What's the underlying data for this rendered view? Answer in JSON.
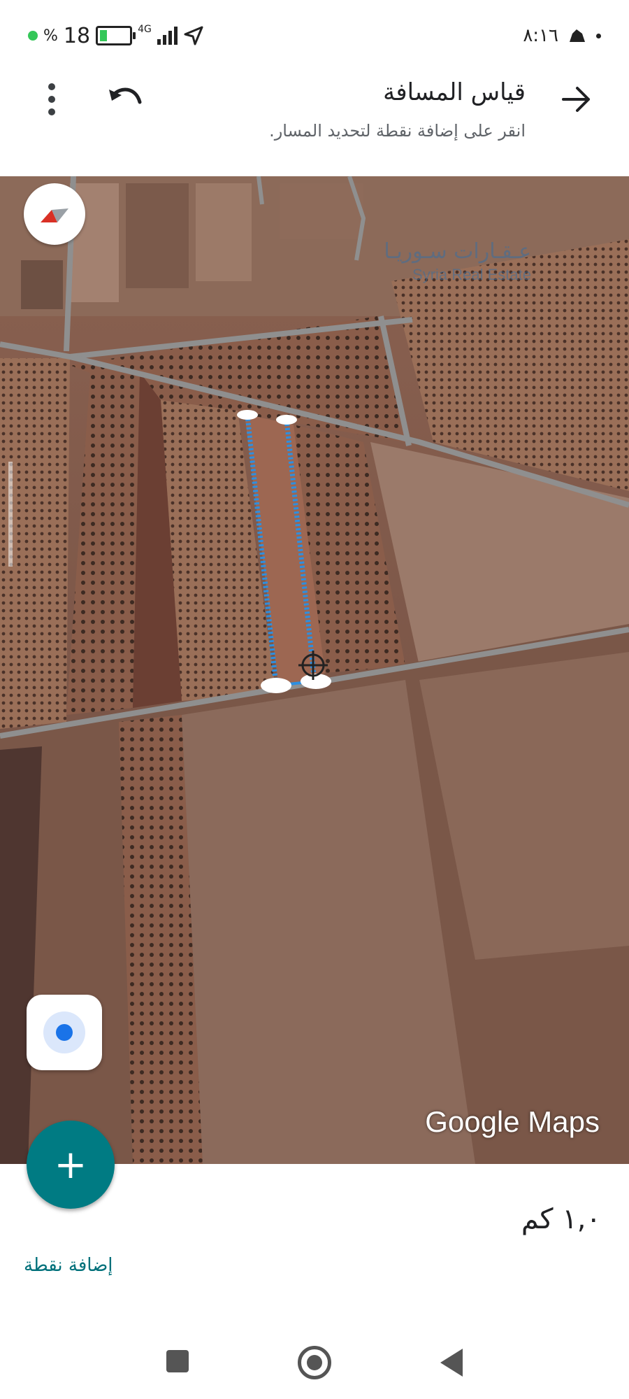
{
  "status_bar": {
    "battery": "18",
    "battery_symbol": "%",
    "network": "4G",
    "time": "٨:١٦"
  },
  "header": {
    "title": "قياس المسافة",
    "subtitle": "انقر على إضافة نقطة لتحديد المسار."
  },
  "map": {
    "attribution": "Google Maps",
    "watermark_ar": "عـقـارات سـوريـا",
    "watermark_en": "Syria Real Estate"
  },
  "measurement": {
    "distance": "١,٠ كم",
    "add_point_label": "إضافة نقطة",
    "fab_symbol": "+"
  },
  "colors": {
    "accent": "#007b83",
    "path": "#2d8fe0",
    "location": "#1a73e8"
  }
}
